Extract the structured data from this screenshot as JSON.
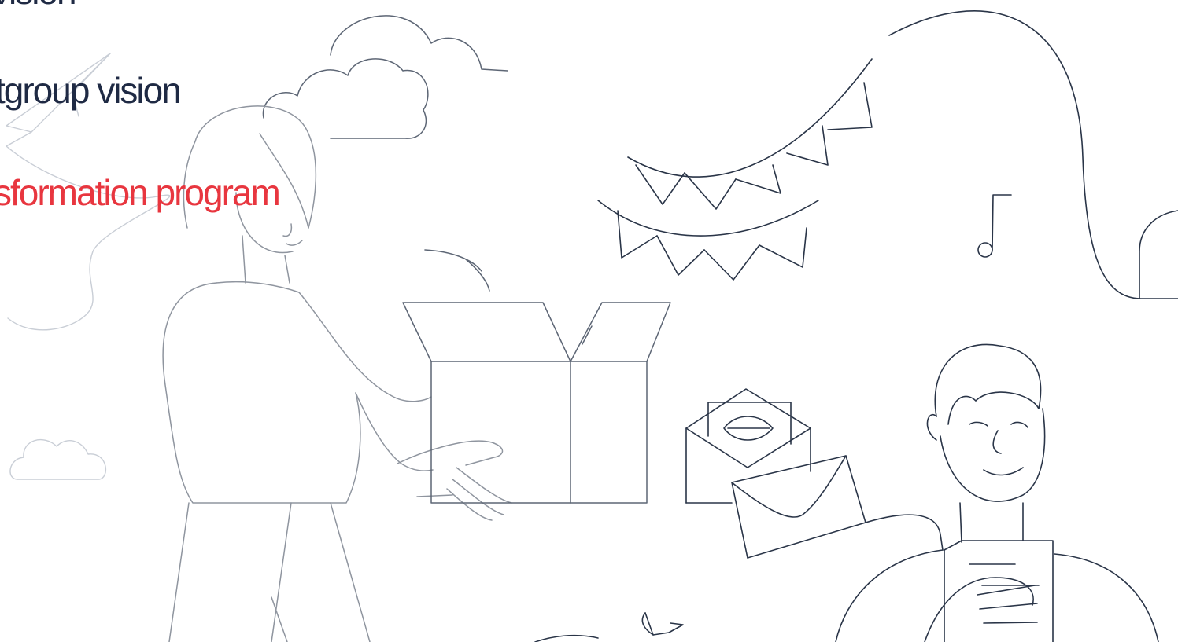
{
  "headlines": {
    "line1": "vision",
    "line2": "tgroup vision",
    "line3": "sformation program"
  },
  "colors": {
    "text_primary": "#1f2a44",
    "accent": "#e8363f",
    "line_dark": "#2a3548",
    "line_light": "#c9ced6"
  },
  "icons": [
    "paper-plane-icon",
    "cloud-icon",
    "open-box-icon",
    "bunting-flags-icon",
    "music-note-icon",
    "envelope-icon",
    "bird-icon"
  ]
}
